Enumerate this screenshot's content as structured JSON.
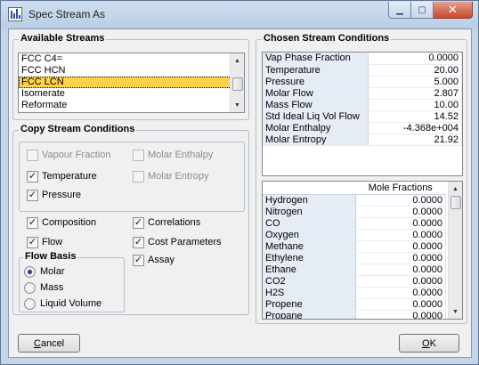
{
  "window": {
    "title": "Spec Stream As"
  },
  "available_streams": {
    "title": "Available Streams",
    "items": [
      "FCC C4=",
      "FCC HCN",
      "FCC LCN",
      "Isomerate",
      "Reformate"
    ],
    "selected": "FCC LCN"
  },
  "copy_conditions": {
    "title": "Copy Stream Conditions",
    "vapour_fraction": "Vapour Fraction",
    "molar_enthalpy": "Molar Enthalpy",
    "temperature": "Temperature",
    "molar_entropy": "Molar Entropy",
    "pressure": "Pressure"
  },
  "options": {
    "composition": "Composition",
    "correlations": "Correlations",
    "flow": "Flow",
    "cost_parameters": "Cost Parameters",
    "assay": "Assay"
  },
  "flow_basis": {
    "title": "Flow Basis",
    "molar": "Molar",
    "mass": "Mass",
    "liquid_volume": "Liquid Volume",
    "selected": "Molar"
  },
  "chosen_conditions": {
    "title": "Chosen Stream Conditions",
    "rows": [
      {
        "label": "Vap Phase Fraction",
        "value": "0.0000"
      },
      {
        "label": "Temperature",
        "value": "20.00"
      },
      {
        "label": "Pressure",
        "value": "5.000"
      },
      {
        "label": "Molar Flow",
        "value": "2.807"
      },
      {
        "label": "Mass Flow",
        "value": "10.00"
      },
      {
        "label": "Std Ideal Liq Vol Flow",
        "value": "14.52"
      },
      {
        "label": "Molar Enthalpy",
        "value": "-4.368e+004"
      },
      {
        "label": "Molar Entropy",
        "value": "21.92"
      }
    ]
  },
  "mole_fractions": {
    "header": "Mole Fractions",
    "rows": [
      {
        "label": "Hydrogen",
        "value": "0.0000"
      },
      {
        "label": "Nitrogen",
        "value": "0.0000"
      },
      {
        "label": "CO",
        "value": "0.0000"
      },
      {
        "label": "Oxygen",
        "value": "0.0000"
      },
      {
        "label": "Methane",
        "value": "0.0000"
      },
      {
        "label": "Ethylene",
        "value": "0.0000"
      },
      {
        "label": "Ethane",
        "value": "0.0000"
      },
      {
        "label": "CO2",
        "value": "0.0000"
      },
      {
        "label": "H2S",
        "value": "0.0000"
      },
      {
        "label": "Propene",
        "value": "0.0000"
      },
      {
        "label": "Propane",
        "value": "0.0000"
      }
    ]
  },
  "buttons": {
    "cancel": "Cancel",
    "ok": "OK"
  },
  "icons": {
    "app": "bar-chart-icon",
    "minimize": "minimize-icon",
    "maximize": "maximize-icon",
    "close": "close-icon"
  }
}
